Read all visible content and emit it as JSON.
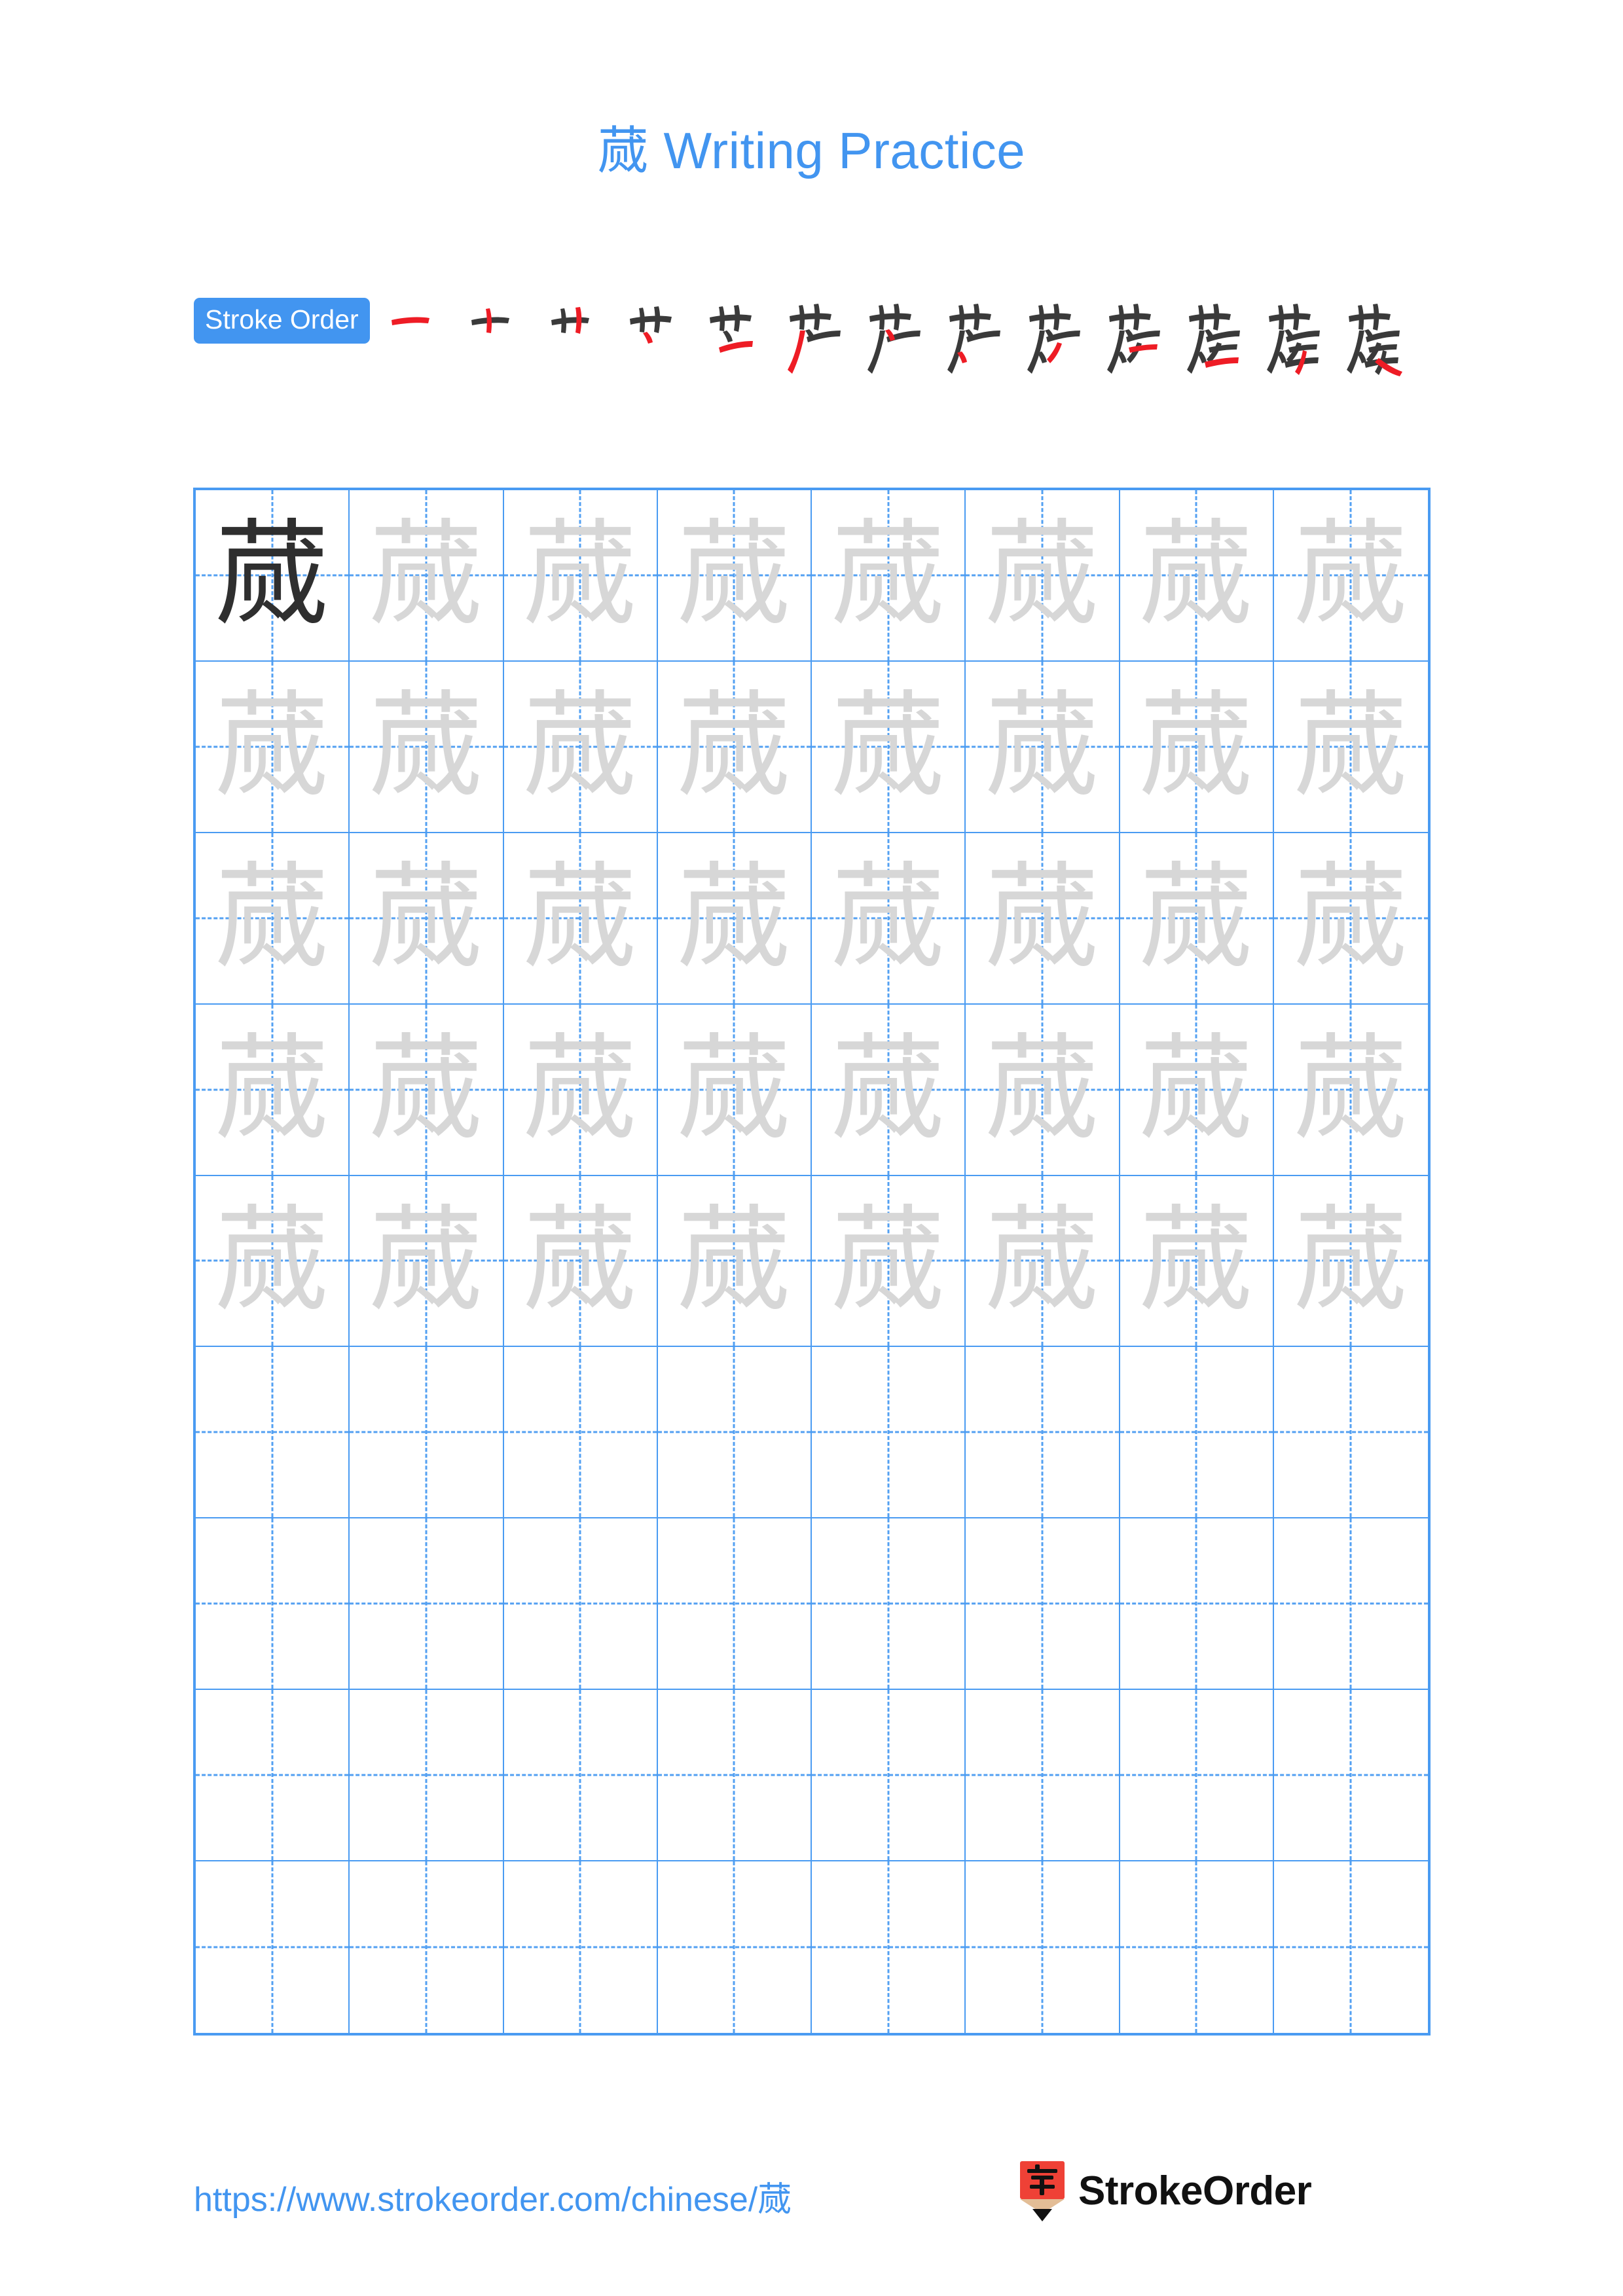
{
  "page": {
    "character": "蒇",
    "title": "蒇 Writing Practice",
    "title_prefix": "蒇",
    "title_suffix": " Writing Practice",
    "accent_color": "#4295f0",
    "grid_line_color": "#4a9bf2",
    "trace_color": "#d7d7d7",
    "ink_color": "#2f2f2f",
    "highlight_stroke_color": "#ee1c25"
  },
  "stroke_order": {
    "badge_label": "Stroke Order",
    "total_strokes": 13,
    "steps": [
      {
        "index": 1,
        "glyph": "一",
        "new_stroke": "heng"
      },
      {
        "index": 2,
        "glyph": "十",
        "new_stroke": "shu"
      },
      {
        "index": 3,
        "glyph": "卄",
        "new_stroke": "shu"
      },
      {
        "index": 4,
        "glyph": "艹",
        "new_stroke": "heng"
      },
      {
        "index": 5,
        "glyph": "艺",
        "new_stroke": "heng"
      },
      {
        "index": 6,
        "glyph": "产",
        "new_stroke": "pie"
      },
      {
        "index": 7,
        "glyph": "芦",
        "new_stroke": "dian"
      },
      {
        "index": 8,
        "glyph": "芦",
        "new_stroke": "pie"
      },
      {
        "index": 9,
        "glyph": "芦",
        "new_stroke": "pie"
      },
      {
        "index": 10,
        "glyph": "芦",
        "new_stroke": "heng"
      },
      {
        "index": 11,
        "glyph": "莀",
        "new_stroke": "heng"
      },
      {
        "index": 12,
        "glyph": "蒇",
        "new_stroke": "pie"
      },
      {
        "index": 13,
        "glyph": "蒇",
        "new_stroke": "na"
      }
    ]
  },
  "practice_grid": {
    "columns": 8,
    "rows": 9,
    "cells": [
      [
        "dark",
        "trace",
        "trace",
        "trace",
        "trace",
        "trace",
        "trace",
        "trace"
      ],
      [
        "trace",
        "trace",
        "trace",
        "trace",
        "trace",
        "trace",
        "trace",
        "trace"
      ],
      [
        "trace",
        "trace",
        "trace",
        "trace",
        "trace",
        "trace",
        "trace",
        "trace"
      ],
      [
        "trace",
        "trace",
        "trace",
        "trace",
        "trace",
        "trace",
        "trace",
        "trace"
      ],
      [
        "trace",
        "trace",
        "trace",
        "trace",
        "trace",
        "trace",
        "trace",
        "trace"
      ],
      [
        "empty",
        "empty",
        "empty",
        "empty",
        "empty",
        "empty",
        "empty",
        "empty"
      ],
      [
        "empty",
        "empty",
        "empty",
        "empty",
        "empty",
        "empty",
        "empty",
        "empty"
      ],
      [
        "empty",
        "empty",
        "empty",
        "empty",
        "empty",
        "empty",
        "empty",
        "empty"
      ],
      [
        "empty",
        "empty",
        "empty",
        "empty",
        "empty",
        "empty",
        "empty",
        "empty"
      ]
    ]
  },
  "footer": {
    "url": "https://www.strokeorder.com/chinese/蒇",
    "logo_text": "StrokeOrder",
    "logo_character": "字",
    "logo_color": "#ef4136",
    "logo_pencil_wood": "#e3bd96"
  }
}
